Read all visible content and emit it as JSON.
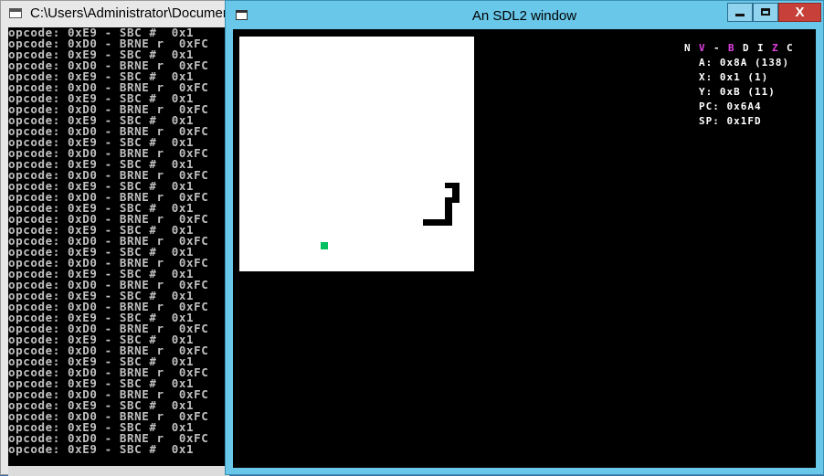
{
  "console": {
    "title": "C:\\Users\\Administrator\\Documents",
    "lines": [
      "opcode: 0xE9 - SBC #  0x1",
      "opcode: 0xD0 - BRNE r  0xFC",
      "opcode: 0xE9 - SBC #  0x1",
      "opcode: 0xD0 - BRNE r  0xFC",
      "opcode: 0xE9 - SBC #  0x1",
      "opcode: 0xD0 - BRNE r  0xFC",
      "opcode: 0xE9 - SBC #  0x1",
      "opcode: 0xD0 - BRNE r  0xFC",
      "opcode: 0xE9 - SBC #  0x1",
      "opcode: 0xD0 - BRNE r  0xFC",
      "opcode: 0xE9 - SBC #  0x1",
      "opcode: 0xD0 - BRNE r  0xFC",
      "opcode: 0xE9 - SBC #  0x1",
      "opcode: 0xD0 - BRNE r  0xFC",
      "opcode: 0xE9 - SBC #  0x1",
      "opcode: 0xD0 - BRNE r  0xFC",
      "opcode: 0xE9 - SBC #  0x1",
      "opcode: 0xD0 - BRNE r  0xFC",
      "opcode: 0xE9 - SBC #  0x1",
      "opcode: 0xD0 - BRNE r  0xFC",
      "opcode: 0xE9 - SBC #  0x1",
      "opcode: 0xD0 - BRNE r  0xFC",
      "opcode: 0xE9 - SBC #  0x1",
      "opcode: 0xD0 - BRNE r  0xFC",
      "opcode: 0xE9 - SBC #  0x1",
      "opcode: 0xD0 - BRNE r  0xFC",
      "opcode: 0xE9 - SBC #  0x1",
      "opcode: 0xD0 - BRNE r  0xFC",
      "opcode: 0xE9 - SBC #  0x1",
      "opcode: 0xD0 - BRNE r  0xFC",
      "opcode: 0xE9 - SBC #  0x1",
      "opcode: 0xD0 - BRNE r  0xFC",
      "opcode: 0xE9 - SBC #  0x1",
      "opcode: 0xD0 - BRNE r  0xFC",
      "opcode: 0xE9 - SBC #  0x1",
      "opcode: 0xD0 - BRNE r  0xFC",
      "opcode: 0xE9 - SBC #  0x1",
      "opcode: 0xD0 - BRNE r  0xFC",
      "opcode: 0xE9 - SBC #  0x1"
    ]
  },
  "sdl_window": {
    "title": "An SDL2 window",
    "close_glyph": "X"
  },
  "status": {
    "flags": [
      {
        "label": "N",
        "color": "#ffffff"
      },
      {
        "label": "V",
        "color": "#e040e0"
      },
      {
        "label": "-",
        "color": "#ffffff"
      },
      {
        "label": "B",
        "color": "#e040e0"
      },
      {
        "label": "D",
        "color": "#ffffff"
      },
      {
        "label": "I",
        "color": "#ffffff"
      },
      {
        "label": "Z",
        "color": "#e040e0"
      },
      {
        "label": "C",
        "color": "#ffffff"
      }
    ],
    "registers": [
      "A: 0x8A (138)",
      "X: 0x1 (1)",
      "Y: 0xB (11)",
      "PC: 0x6A4",
      "SP: 0x1FD"
    ]
  },
  "colors": {
    "snake": "#000000",
    "food": "#00c060",
    "screen_bg": "#ffffff"
  }
}
